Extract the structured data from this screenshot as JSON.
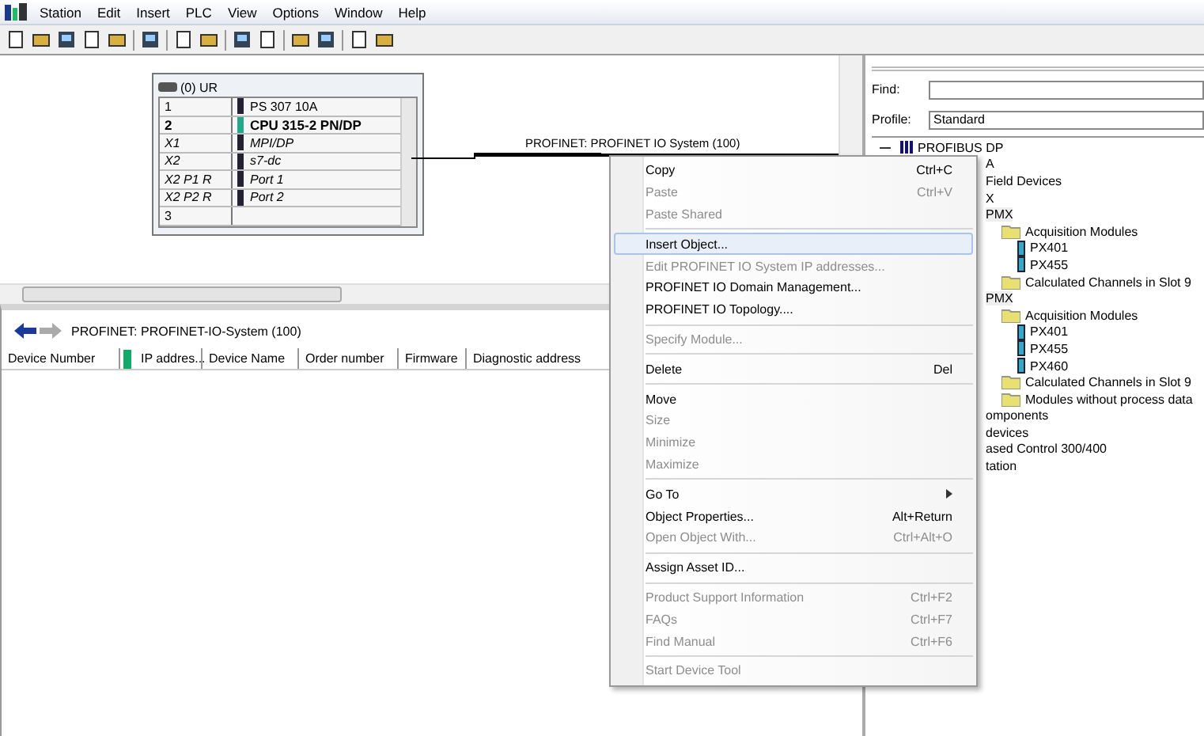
{
  "menu_bar": [
    "Station",
    "Edit",
    "Insert",
    "PLC",
    "View",
    "Options",
    "Window",
    "Help"
  ],
  "rack": {
    "title": "(0) UR",
    "rows": [
      {
        "slot": "1",
        "module": "PS 307 10A",
        "kind": "module"
      },
      {
        "slot": "2",
        "module": "CPU 315-2 PN/DP",
        "kind": "cpu"
      },
      {
        "slot": "X1",
        "module": "MPI/DP",
        "kind": "interface"
      },
      {
        "slot": "X2",
        "module": "s7-dc",
        "kind": "interface"
      },
      {
        "slot": "X2 P1 R",
        "module": "Port 1",
        "kind": "interface"
      },
      {
        "slot": "X2 P2 R",
        "module": "Port 2",
        "kind": "interface"
      },
      {
        "slot": "3",
        "kind": "empty"
      }
    ]
  },
  "bus_label": "PROFINET: PROFINET IO System (100)",
  "detail": {
    "title": "PROFINET: PROFINET-IO-System (100)",
    "columns": [
      "Device Number",
      "IP addres...",
      "Device Name",
      "Order number",
      "Firmware",
      "Diagnostic address"
    ]
  },
  "catalog": {
    "find_label": "Find:",
    "profile_label": "Profile:",
    "profile": "Standard",
    "top_item": "PROFIBUS DP",
    "tree": [
      {
        "label": "A",
        "kind": "fragment"
      },
      {
        "label": "Field Devices",
        "kind": "fragment"
      },
      {
        "label": "X",
        "kind": "fragment"
      },
      {
        "label": "PMX",
        "kind": "device",
        "children": [
          {
            "label": "Acquisition Modules",
            "kind": "folder",
            "children": [
              {
                "label": "PX401",
                "kind": "module"
              },
              {
                "label": "PX455",
                "kind": "module"
              }
            ]
          },
          {
            "label": "Calculated Channels in Slot 9",
            "kind": "folder"
          }
        ]
      },
      {
        "label": "PMX",
        "kind": "device",
        "children": [
          {
            "label": "Acquisition Modules",
            "kind": "folder",
            "children": [
              {
                "label": "PX401",
                "kind": "module"
              },
              {
                "label": "PX455",
                "kind": "module"
              },
              {
                "label": "PX460",
                "kind": "module"
              }
            ]
          },
          {
            "label": "Calculated Channels in Slot 9",
            "kind": "folder"
          },
          {
            "label": "Modules without process data",
            "kind": "folder"
          }
        ]
      },
      {
        "label": "omponents",
        "kind": "fragment"
      },
      {
        "label": "devices",
        "kind": "fragment"
      },
      {
        "label": "ased Control 300/400",
        "kind": "fragment"
      },
      {
        "label": "tation",
        "kind": "fragment"
      }
    ]
  },
  "context_menu": [
    {
      "kind": "item",
      "label": "Copy",
      "shortcut": "Ctrl+C",
      "disabled": false,
      "selected": false
    },
    {
      "kind": "item",
      "label": "Paste",
      "shortcut": "Ctrl+V",
      "disabled": true,
      "selected": false
    },
    {
      "kind": "item",
      "label": "Paste Shared",
      "disabled": true,
      "selected": false
    },
    {
      "kind": "separator"
    },
    {
      "kind": "item",
      "label": "Insert Object...",
      "disabled": false,
      "selected": true
    },
    {
      "kind": "item",
      "label": "Edit PROFINET IO System IP addresses...",
      "disabled": true,
      "selected": false
    },
    {
      "kind": "item",
      "label": "PROFINET IO Domain Management...",
      "disabled": false,
      "selected": false
    },
    {
      "kind": "item",
      "label": "PROFINET IO Topology....",
      "disabled": false,
      "selected": false
    },
    {
      "kind": "separator"
    },
    {
      "kind": "item",
      "label": "Specify Module...",
      "disabled": true,
      "selected": false
    },
    {
      "kind": "separator"
    },
    {
      "kind": "item",
      "label": "Delete",
      "shortcut": "Del",
      "disabled": false,
      "selected": false
    },
    {
      "kind": "separator"
    },
    {
      "kind": "item",
      "label": "Move",
      "disabled": false,
      "selected": false
    },
    {
      "kind": "item",
      "label": "Size",
      "disabled": true,
      "selected": false
    },
    {
      "kind": "item",
      "label": "Minimize",
      "disabled": true,
      "selected": false
    },
    {
      "kind": "item",
      "label": "Maximize",
      "disabled": true,
      "selected": false
    },
    {
      "kind": "separator"
    },
    {
      "kind": "submenu",
      "label": "Go To",
      "disabled": false,
      "selected": false
    },
    {
      "kind": "item",
      "label": "Object Properties...",
      "shortcut": "Alt+Return",
      "disabled": false,
      "selected": false
    },
    {
      "kind": "item",
      "label": "Open Object With...",
      "shortcut": "Ctrl+Alt+O",
      "disabled": true,
      "selected": false
    },
    {
      "kind": "separator"
    },
    {
      "kind": "item",
      "label": "Assign Asset ID...",
      "disabled": false,
      "selected": false
    },
    {
      "kind": "separator"
    },
    {
      "kind": "item",
      "label": "Product Support Information",
      "shortcut": "Ctrl+F2",
      "disabled": true,
      "selected": false
    },
    {
      "kind": "item",
      "label": "FAQs",
      "shortcut": "Ctrl+F7",
      "disabled": true,
      "selected": false
    },
    {
      "kind": "item",
      "label": "Find Manual",
      "shortcut": "Ctrl+F6",
      "disabled": true,
      "selected": false
    },
    {
      "kind": "separator"
    },
    {
      "kind": "item",
      "label": "Start Device Tool",
      "disabled": true,
      "selected": false
    }
  ]
}
